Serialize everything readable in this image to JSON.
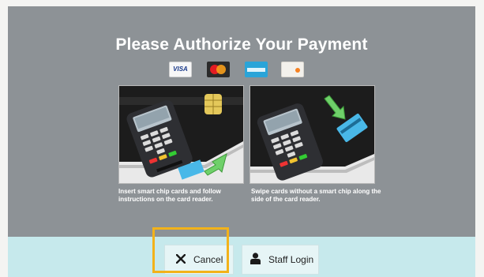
{
  "screen": {
    "title": "Please Authorize Your Payment",
    "card_logos": [
      "visa-logo",
      "mastercard-logo",
      "amex-logo",
      "discover-logo"
    ],
    "visa_text": "VISA",
    "instructions": [
      {
        "illustration": "chip-card-insert",
        "caption": "Insert smart chip cards and follow instructions on the card reader."
      },
      {
        "illustration": "card-swipe",
        "caption": "Swipe cards without a smart chip along the side of the card reader."
      }
    ]
  },
  "actions": {
    "cancel_label": "Cancel",
    "cancel_icon": "close-icon",
    "staff_login_label": "Staff Login",
    "staff_login_icon": "user-icon"
  },
  "colors": {
    "screen_bg": "#8d9296",
    "bottom_bar": "#c6e9ec",
    "highlight": "#f2b21a",
    "arrow": "#6fd06a"
  }
}
